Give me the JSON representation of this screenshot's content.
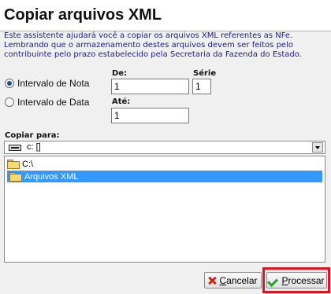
{
  "title": "Copiar arquivos XML",
  "intro": "Este assistente ajudará você a copiar os arquivos XML referentes as NFe. Lembrando que o armazenamento destes arquivos devem ser feitos pelo contribuinte pelo prazo estabelecido pela Secretaria da Fazenda do Estado.",
  "options": {
    "nota_label": "Intervalo de Nota",
    "data_label": "Intervalo de Data",
    "selected": "nota"
  },
  "fields": {
    "de_label": "De:",
    "de_value": "1",
    "serie_label": "Série",
    "serie_value": "1",
    "ate_label": "Até:",
    "ate_value": "1"
  },
  "copy_to": {
    "label": "Copiar para:",
    "drive_value": "c: []",
    "drive_icon": "drive-icon"
  },
  "tree": {
    "items": [
      {
        "label": "C:\\",
        "icon": "folder-open-icon",
        "selected": false
      },
      {
        "label": "Arquivos XML",
        "icon": "folder-open-icon",
        "selected": true
      }
    ]
  },
  "buttons": {
    "cancel_underline": "C",
    "cancel_rest": "ancelar",
    "process_underline": "P",
    "process_rest": "rocessar"
  },
  "colors": {
    "selection": "#3399ff",
    "intro_text": "#1c1c8c",
    "highlight_border": "#e0141e",
    "cancel_icon": "#c8281e",
    "process_icon": "#2e9e2e"
  }
}
